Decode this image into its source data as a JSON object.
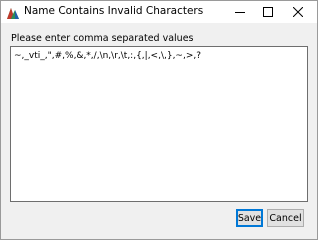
{
  "window": {
    "title": "Name Contains Invalid Characters",
    "icon": "app-logo-icon"
  },
  "titlebar_buttons": {
    "minimize_icon": "minimize-icon",
    "maximize_icon": "maximize-icon",
    "close_icon": "close-icon"
  },
  "dialog": {
    "prompt": "Please enter comma separated values",
    "value": "~,_vti_,\",#,%,&,*,/,\\n,\\r,\\t,:,{,|,<,\\,},~,>,?"
  },
  "buttons": {
    "save_label": "Save",
    "cancel_label": "Cancel"
  },
  "colors": {
    "focus_accent": "#0078d7"
  }
}
